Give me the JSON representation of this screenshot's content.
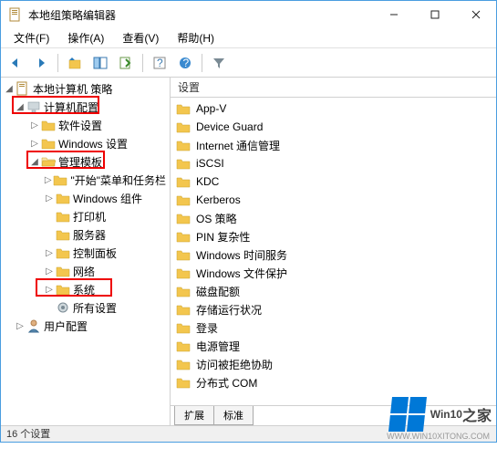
{
  "window": {
    "title": "本地组策略编辑器"
  },
  "menu": {
    "file": "文件(F)",
    "action": "操作(A)",
    "view": "查看(V)",
    "help": "帮助(H)"
  },
  "tree": {
    "root": "本地计算机 策略",
    "computer_config": "计算机配置",
    "software_settings": "软件设置",
    "windows_settings": "Windows 设置",
    "admin_templates": "管理模板",
    "start_menu": "\"开始\"菜单和任务栏",
    "windows_components": "Windows 组件",
    "printers": "打印机",
    "servers": "服务器",
    "control_panel": "控制面板",
    "network": "网络",
    "system": "系统",
    "all_settings": "所有设置",
    "user_config": "用户配置"
  },
  "list": {
    "header": "设置",
    "items": [
      "App-V",
      "Device Guard",
      "Internet 通信管理",
      "iSCSI",
      "KDC",
      "Kerberos",
      "OS 策略",
      "PIN 复杂性",
      "Windows 时间服务",
      "Windows 文件保护",
      "磁盘配额",
      "存储运行状况",
      "登录",
      "电源管理",
      "访问被拒绝协助",
      "分布式 COM"
    ]
  },
  "tabs": {
    "extended": "扩展",
    "standard": "标准"
  },
  "status": "16 个设置",
  "watermark": {
    "brand": "Win10",
    "suffix": "之家",
    "url": "WWW.WIN10XITONG.COM"
  }
}
